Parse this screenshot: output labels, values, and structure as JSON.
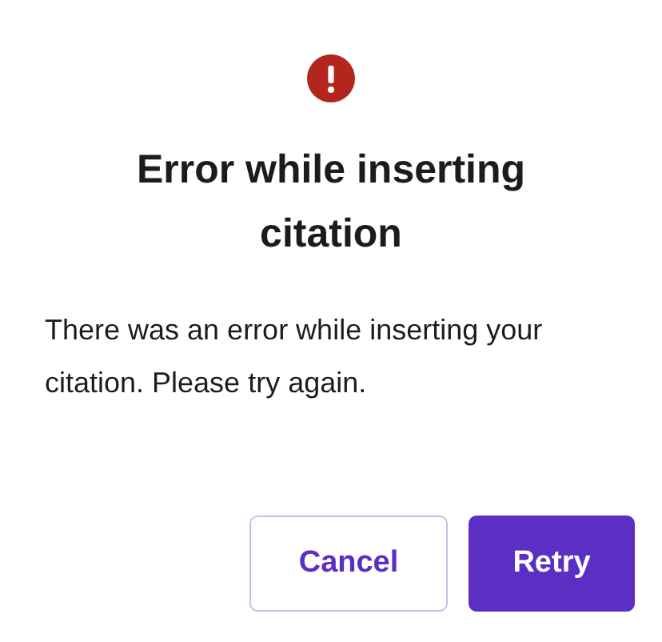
{
  "dialog": {
    "title": "Error while inserting citation",
    "message": "There was an error while inserting your citation. Please try again.",
    "buttons": [
      {
        "label": "Cancel",
        "kind": "secondary"
      },
      {
        "label": "Retry",
        "kind": "primary"
      }
    ]
  }
}
